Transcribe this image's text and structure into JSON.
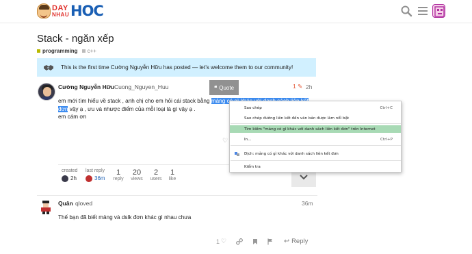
{
  "header": {
    "logo": {
      "day": "DAY",
      "nhau": "NHAU",
      "hoc": "HOC"
    },
    "icons": [
      "search-icon",
      "hamburger-menu-icon",
      "user-avatar"
    ]
  },
  "topic": {
    "title": "Stack - ngăn xếp",
    "category": "programming",
    "subcategory": "c++",
    "category_color": "#b9b900"
  },
  "banner": {
    "text": "This is the first time Cường Nguyễn Hữu has posted — let’s welcome them to our community!"
  },
  "post1": {
    "name": "Cường Nguyễn Hữu",
    "username": "Cuong_Nguyen_Huu",
    "quote_label": "Quote",
    "edits": "1",
    "time": "2h",
    "line1_pre": "em mới tìm hiểu về stack , anh chị cho em hỏi cái stack bằng ",
    "line1_hl": "mảng có gì khác với danh sách liên kết",
    "line2_hl": "đơn",
    "line2_post": " vậy ạ , ưu và nhược điểm của mỗi loại là gì vậy ạ .",
    "line3": "em cám ơn"
  },
  "topic_map": {
    "created_label": "created",
    "created_time": "2h",
    "last_reply_label": "last reply",
    "last_reply_time": "36m",
    "reply_count": "1",
    "reply_label": "reply",
    "views_count": "20",
    "views_label": "views",
    "users_count": "2",
    "users_label": "users",
    "like_count": "1",
    "like_label": "like"
  },
  "post2": {
    "name": "Quân",
    "username": "qloved",
    "time": "36m",
    "body": "Thế bạn đã biết mảng và dslk đơn khác gì nhau chưa",
    "like_count": "1",
    "reply_label": "Reply"
  },
  "context_menu": {
    "items": [
      {
        "label": "Sao chép",
        "shortcut": "Ctrl+C"
      },
      {
        "label": "Sao chép đường liên kết đến văn bản được làm nổi bật",
        "shortcut": ""
      },
      {
        "label": "Tìm kiếm \"mảng có gì khác với danh sách liên kết đơn\" trên Internet",
        "shortcut": ""
      },
      {
        "label": "In...",
        "shortcut": "Ctrl+P"
      },
      {
        "label": "Dịch: mảng có gì khác với danh sách liên kết đơn",
        "shortcut": ""
      },
      {
        "label": "Kiểm tra",
        "shortcut": ""
      }
    ]
  }
}
